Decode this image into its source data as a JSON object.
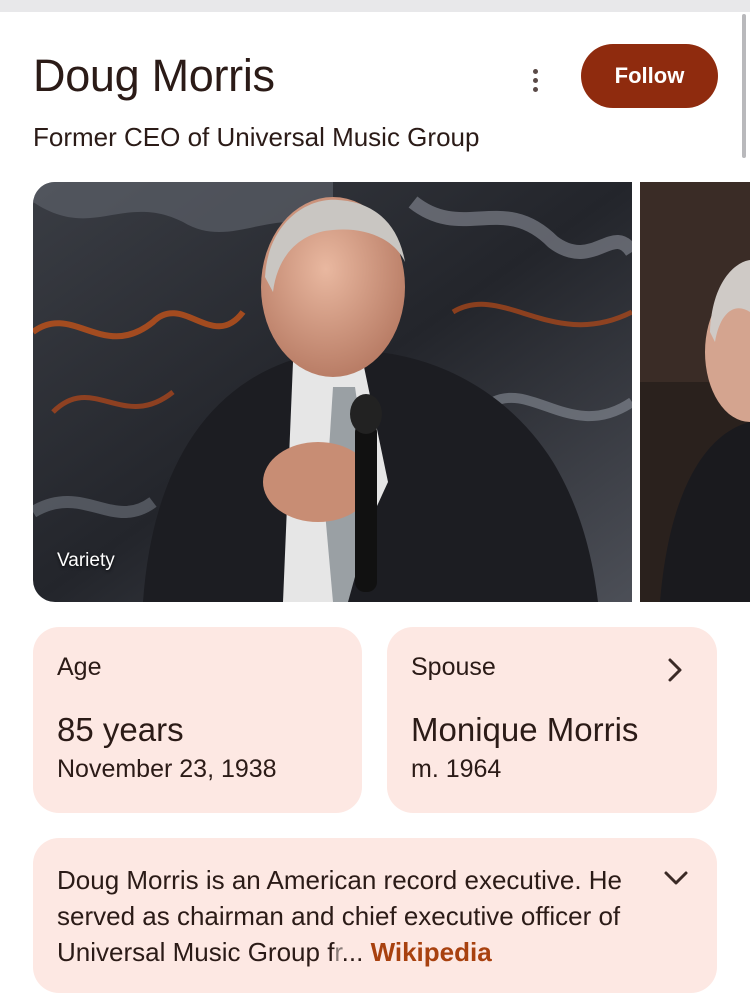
{
  "header": {
    "title": "Doug Morris",
    "subtitle": "Former CEO of Universal Music Group",
    "follow_label": "Follow",
    "more_icon": "more-vert-icon"
  },
  "images": {
    "main_source": "Variety"
  },
  "facts": {
    "age": {
      "label": "Age",
      "value": "85 years",
      "detail": "November 23, 1938"
    },
    "spouse": {
      "label": "Spouse",
      "value": "Monique Morris",
      "detail": "m. 1964"
    }
  },
  "about": {
    "text": "Doug Morris is an American record executive. He served as chairman and chief executive officer of Universal Music Group f",
    "faded": "r",
    "ellipsis": "...",
    "source_link": "Wikipedia"
  },
  "colors": {
    "accent": "#8f2b0e",
    "card_bg": "#fde8e3",
    "link": "#a8410f"
  }
}
